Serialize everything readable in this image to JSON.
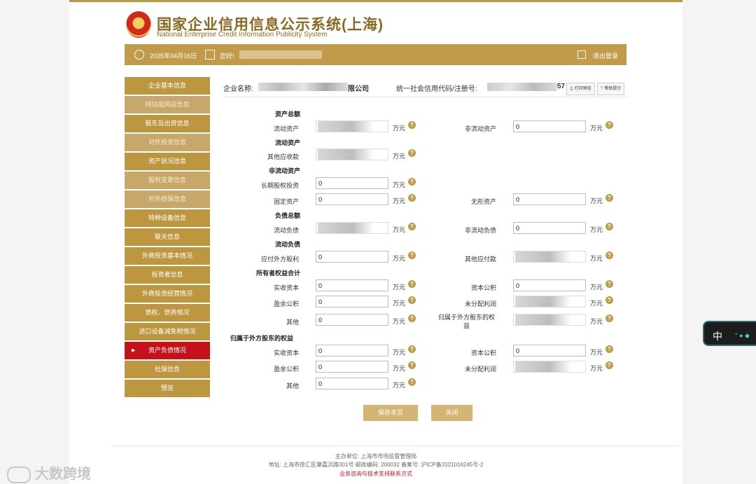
{
  "header": {
    "title_cn": "国家企业信用信息公示系统(上海)",
    "title_en": "National Enterprise Credit Information Publicity System"
  },
  "userbar": {
    "date": "2025年04月16日",
    "greeting": "您好!",
    "logout": "退出登录"
  },
  "sidebar": {
    "items": [
      "企业基本信息",
      "网站或网店信息",
      "股东及出资信息",
      "对外投资信息",
      "资产状况信息",
      "股权变更信息",
      "对外担保信息",
      "特种设备信息",
      "联关信息",
      "外商投资基本情况",
      "投资者信息",
      "外商投资经营情况",
      "债权、债务情况",
      "进口设备减免税情况",
      "资产负债情况",
      "社保信息",
      "预览"
    ],
    "active_index": 14
  },
  "company": {
    "name_label": "企业名称:",
    "name_tail": "限公司",
    "code_label": "统一社会信用代码/注册号:",
    "code_tail": "57",
    "print": "打印预览",
    "help": "帮助提示"
  },
  "form": {
    "unit": "万元",
    "help": "?",
    "sections": {
      "s1": "资产总额",
      "s2": "流动资产",
      "s3": "非流动资产",
      "s4": "负债总额",
      "s5": "流动负债",
      "s6": "所有者权益合计",
      "s7": "归属于外方股东的权益"
    },
    "labels": {
      "l1": "流动资产",
      "r1": "非流动资产",
      "l2": "其他应收款",
      "l3": "长期股权投资",
      "l4": "固定资产",
      "r4": "无形资产",
      "l5": "流动负债",
      "r5": "非流动负债",
      "l6": "应付外方股利",
      "r6": "其他应付款",
      "l7": "实收资本",
      "r7": "资本公积",
      "l8": "盈余公积",
      "r8": "未分配利润",
      "l9": "其他",
      "r9": "归属于外方股东的权益",
      "l10": "实收资本",
      "r10": "资本公积",
      "l11": "盈余公积",
      "r11": "未分配利润",
      "l12": "其他"
    },
    "values": {
      "r1": "0",
      "l3": "0",
      "l4": "0",
      "r4": "0",
      "r5": "0",
      "l6": "0",
      "l7": "0",
      "r7": "0",
      "l8": "0",
      "l9": "0",
      "l10": "0",
      "r10": "0",
      "l11": "0",
      "l12": "0"
    }
  },
  "actions": {
    "save": "保存本页",
    "close": "关闭"
  },
  "footer": {
    "sponsor": "主办单位:   上海市市场监督管理局",
    "address": "地址:   上海市徐汇区肇嘉浜路301号 邮政编码:   200032 备案号:   沪ICP备2021016245号-2",
    "support": "业务咨询与技术支持联系方式"
  },
  "watermark": "大数跨境",
  "ime": {
    "label": "中"
  }
}
